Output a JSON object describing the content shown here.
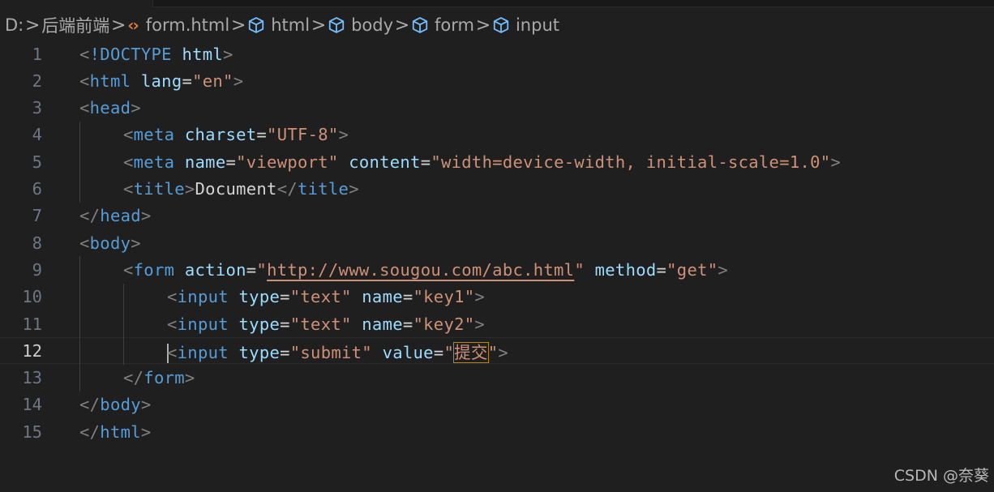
{
  "breadcrumb": {
    "items": [
      {
        "label": "D:",
        "icon": null
      },
      {
        "label": "后端前端",
        "icon": null
      },
      {
        "label": "form.html",
        "icon": "html-file-icon"
      },
      {
        "label": "html",
        "icon": "symbol-cube-icon"
      },
      {
        "label": "body",
        "icon": "symbol-cube-icon"
      },
      {
        "label": "form",
        "icon": "symbol-cube-icon"
      },
      {
        "label": "input",
        "icon": "symbol-cube-icon"
      }
    ],
    "separator": ">"
  },
  "editor": {
    "current_line": 12,
    "colors": {
      "background": "#1f1f1f",
      "tag": "#569cd6",
      "attribute": "#9cdcfe",
      "string": "#ce9178",
      "punctuation": "#808080",
      "line_number": "#6e7681"
    },
    "lines": [
      {
        "n": "1",
        "indent": 0,
        "tokens": [
          [
            "punc",
            "<"
          ],
          [
            "tag",
            "!DOCTYPE"
          ],
          [
            "text",
            " "
          ],
          [
            "attr",
            "html"
          ],
          [
            "punc",
            ">"
          ]
        ]
      },
      {
        "n": "2",
        "indent": 0,
        "tokens": [
          [
            "punc",
            "<"
          ],
          [
            "tag",
            "html"
          ],
          [
            "text",
            " "
          ],
          [
            "attr",
            "lang"
          ],
          [
            "eq",
            "="
          ],
          [
            "str",
            "\"en\""
          ],
          [
            "punc",
            ">"
          ]
        ]
      },
      {
        "n": "3",
        "indent": 0,
        "tokens": [
          [
            "punc",
            "<"
          ],
          [
            "tag",
            "head"
          ],
          [
            "punc",
            ">"
          ]
        ]
      },
      {
        "n": "4",
        "indent": 1,
        "tokens": [
          [
            "punc",
            "<"
          ],
          [
            "tag",
            "meta"
          ],
          [
            "text",
            " "
          ],
          [
            "attr",
            "charset"
          ],
          [
            "eq",
            "="
          ],
          [
            "str",
            "\"UTF-8\""
          ],
          [
            "punc",
            ">"
          ]
        ]
      },
      {
        "n": "5",
        "indent": 1,
        "tokens": [
          [
            "punc",
            "<"
          ],
          [
            "tag",
            "meta"
          ],
          [
            "text",
            " "
          ],
          [
            "attr",
            "name"
          ],
          [
            "eq",
            "="
          ],
          [
            "str",
            "\"viewport\""
          ],
          [
            "text",
            " "
          ],
          [
            "attr",
            "content"
          ],
          [
            "eq",
            "="
          ],
          [
            "str",
            "\"width=device-width, initial-scale=1.0\""
          ],
          [
            "punc",
            ">"
          ]
        ]
      },
      {
        "n": "6",
        "indent": 1,
        "tokens": [
          [
            "punc",
            "<"
          ],
          [
            "tag",
            "title"
          ],
          [
            "punc",
            ">"
          ],
          [
            "text",
            "Document"
          ],
          [
            "punc",
            "</"
          ],
          [
            "tag",
            "title"
          ],
          [
            "punc",
            ">"
          ]
        ]
      },
      {
        "n": "7",
        "indent": 0,
        "tokens": [
          [
            "punc",
            "</"
          ],
          [
            "tag",
            "head"
          ],
          [
            "punc",
            ">"
          ]
        ]
      },
      {
        "n": "8",
        "indent": 0,
        "tokens": [
          [
            "punc",
            "<"
          ],
          [
            "tag",
            "body"
          ],
          [
            "punc",
            ">"
          ]
        ]
      },
      {
        "n": "9",
        "indent": 1,
        "tokens": [
          [
            "punc",
            "<"
          ],
          [
            "tag",
            "form"
          ],
          [
            "text",
            " "
          ],
          [
            "attr",
            "action"
          ],
          [
            "eq",
            "="
          ],
          [
            "str",
            "\""
          ],
          [
            "link",
            "http://www.sougou.com/abc.html"
          ],
          [
            "str",
            "\""
          ],
          [
            "text",
            " "
          ],
          [
            "attr",
            "method"
          ],
          [
            "eq",
            "="
          ],
          [
            "str",
            "\"get\""
          ],
          [
            "punc",
            ">"
          ]
        ]
      },
      {
        "n": "10",
        "indent": 2,
        "tokens": [
          [
            "punc",
            "<"
          ],
          [
            "tag",
            "input"
          ],
          [
            "text",
            " "
          ],
          [
            "attr",
            "type"
          ],
          [
            "eq",
            "="
          ],
          [
            "str",
            "\"text\""
          ],
          [
            "text",
            " "
          ],
          [
            "attr",
            "name"
          ],
          [
            "eq",
            "="
          ],
          [
            "str",
            "\"key1\""
          ],
          [
            "punc",
            ">"
          ]
        ]
      },
      {
        "n": "11",
        "indent": 2,
        "tokens": [
          [
            "punc",
            "<"
          ],
          [
            "tag",
            "input"
          ],
          [
            "text",
            " "
          ],
          [
            "attr",
            "type"
          ],
          [
            "eq",
            "="
          ],
          [
            "str",
            "\"text\""
          ],
          [
            "text",
            " "
          ],
          [
            "attr",
            "name"
          ],
          [
            "eq",
            "="
          ],
          [
            "str",
            "\"key2\""
          ],
          [
            "punc",
            ">"
          ]
        ]
      },
      {
        "n": "12",
        "indent": 2,
        "tokens": [
          [
            "cursor",
            ""
          ],
          [
            "punc",
            "<"
          ],
          [
            "tag",
            "input"
          ],
          [
            "text",
            " "
          ],
          [
            "attr",
            "type"
          ],
          [
            "eq",
            "="
          ],
          [
            "str",
            "\"submit\""
          ],
          [
            "text",
            " "
          ],
          [
            "attr",
            "value"
          ],
          [
            "eq",
            "="
          ],
          [
            "str",
            "\""
          ],
          [
            "hl",
            "提交"
          ],
          [
            "str",
            "\""
          ],
          [
            "punc",
            ">"
          ]
        ]
      },
      {
        "n": "13",
        "indent": 1,
        "tokens": [
          [
            "punc",
            "</"
          ],
          [
            "tag",
            "form"
          ],
          [
            "punc",
            ">"
          ]
        ]
      },
      {
        "n": "14",
        "indent": 0,
        "tokens": [
          [
            "punc",
            "</"
          ],
          [
            "tag",
            "body"
          ],
          [
            "punc",
            ">"
          ]
        ]
      },
      {
        "n": "15",
        "indent": 0,
        "tokens": [
          [
            "punc",
            "</"
          ],
          [
            "tag",
            "html"
          ],
          [
            "punc",
            ">"
          ]
        ]
      }
    ]
  },
  "watermark": "CSDN @奈葵"
}
